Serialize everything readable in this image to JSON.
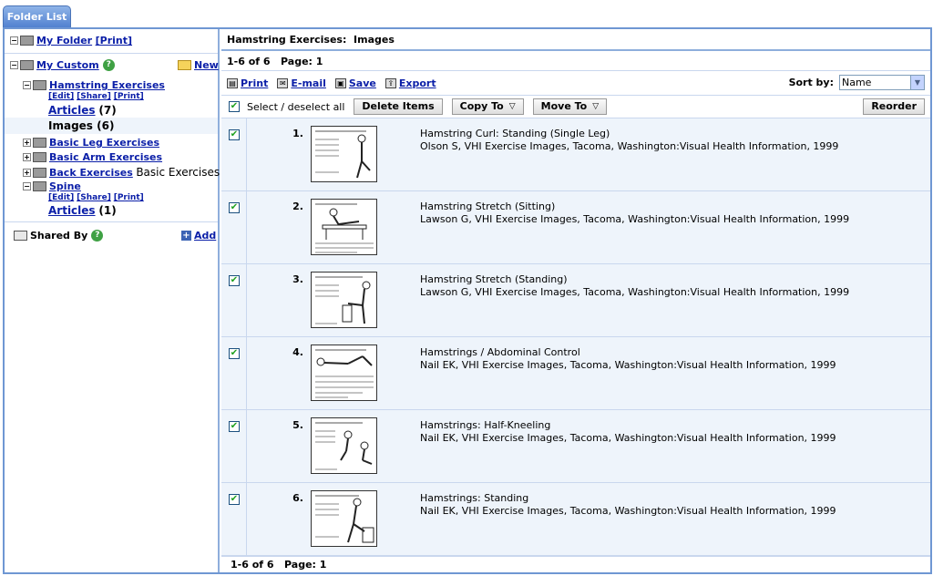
{
  "tab": {
    "label": "Folder List"
  },
  "sidebar": {
    "my_folder": "My Folder",
    "my_folder_print": "[Print]",
    "my_custom": "My Custom",
    "new": "New",
    "hamstring": {
      "label": "Hamstring Exercises",
      "edit": "[Edit]",
      "share": "[Share]",
      "print": "[Print]",
      "articles": "Articles",
      "articles_count": "(7)",
      "images": "Images (6)"
    },
    "basic_leg": "Basic Leg Exercises",
    "basic_arm": "Basic Arm Exercises",
    "back": "Back Exercises",
    "back_extra": "Basic Exercises",
    "spine": {
      "label": "Spine",
      "edit": "[Edit]",
      "share": "[Share]",
      "print": "[Print]",
      "articles": "Articles",
      "articles_count": "(1)"
    },
    "shared_by": "Shared By",
    "add": "Add"
  },
  "main": {
    "header": "Hamstring Exercises:  Images",
    "paging_top": "1-6 of 6   Page: 1",
    "tools": {
      "print": "Print",
      "email": "E-mail",
      "save": "Save",
      "export": "Export"
    },
    "sort_label": "Sort by:",
    "sort_value": "Name",
    "select_all": "Select / deselect all",
    "delete": "Delete Items",
    "copy_to": "Copy To",
    "move_to": "Move To",
    "reorder": "Reorder",
    "items": [
      {
        "num": "1.",
        "title": "Hamstring Curl: Standing (Single Leg)",
        "cite": "Olson S, VHI Exercise Images, Tacoma, Washington:Visual Health Information, 1999"
      },
      {
        "num": "2.",
        "title": "Hamstring Stretch (Sitting)",
        "cite": "Lawson G, VHI Exercise Images, Tacoma, Washington:Visual Health Information, 1999"
      },
      {
        "num": "3.",
        "title": "Hamstring Stretch (Standing)",
        "cite": "Lawson G, VHI Exercise Images, Tacoma, Washington:Visual Health Information, 1999"
      },
      {
        "num": "4.",
        "title": "Hamstrings / Abdominal Control",
        "cite": "Nail EK, VHI Exercise Images, Tacoma, Washington:Visual Health Information, 1999"
      },
      {
        "num": "5.",
        "title": "Hamstrings: Half-Kneeling",
        "cite": "Nail EK, VHI Exercise Images, Tacoma, Washington:Visual Health Information, 1999"
      },
      {
        "num": "6.",
        "title": "Hamstrings: Standing",
        "cite": "Nail EK, VHI Exercise Images, Tacoma, Washington:Visual Health Information, 1999"
      }
    ],
    "paging_bottom": "1-6 of 6   Page: 1"
  }
}
